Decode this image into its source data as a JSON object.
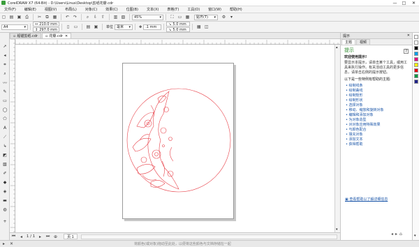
{
  "window": {
    "title": "CorelDRAW X7 (64-Bit) - D:\\Users\\Linus\\Desktop\\剪纸花瓣.cdr",
    "minimize": "—",
    "maximize": "□",
    "close": "✕"
  },
  "menu": [
    "文件(F)",
    "编辑(E)",
    "视图(V)",
    "布局(L)",
    "对象(C)",
    "效果(C)",
    "位图(B)",
    "文本(X)",
    "表格(T)",
    "工具(O)",
    "窗口(W)",
    "帮助(H)"
  ],
  "toolbar": {
    "zoom_value": "45%",
    "snap_label": "贴齐(T)"
  },
  "property_bar": {
    "page_size": "A4",
    "width": "210.0 mm",
    "height": "297.0 mm",
    "unit_label": "单位",
    "unit_value": "毫米",
    "nudge": ".1 mm",
    "dup_x": "5.0 mm",
    "dup_y": "5.0 mm"
  },
  "document_tabs": [
    {
      "label": "船锚剪纸.cdr"
    },
    {
      "label": "花瓣.cdr"
    }
  ],
  "page_nav": {
    "current": "1",
    "separator": "/",
    "total": "1",
    "page_tab": "页 1"
  },
  "status": {
    "hint_text": "将颜色(或对象)拖动至此处，以便将这些颜色与文档存储在一起"
  },
  "docker": {
    "title": "提示",
    "tabs": [
      "主题",
      "视频"
    ],
    "section_title": "提示",
    "welcome": "欢迎使用提示!",
    "intro": "要显示本提示，请单击某个工具，或用工具来执行操作。有关活动工具的更多信息，请单击右侧的提示按钮。",
    "list_heading": "以下是一些特例有帮助的主题:",
    "links": [
      "绘制线条",
      "绘制曲线",
      "绘制矩形",
      "绘制形状",
      "选择对象",
      "移动、缩放和旋转对象",
      "编辑和添加对象",
      "为对象造型",
      "对对象应用特殊效果",
      "与颜色配合",
      "填充对象",
      "添加文本",
      "获得帮助"
    ],
    "more_link": "查看帮助以了解详细信息"
  },
  "colors": {
    "outline_red": "#e8424a",
    "accent_green": "#2e8b2e",
    "link_blue": "#1a55a8"
  }
}
